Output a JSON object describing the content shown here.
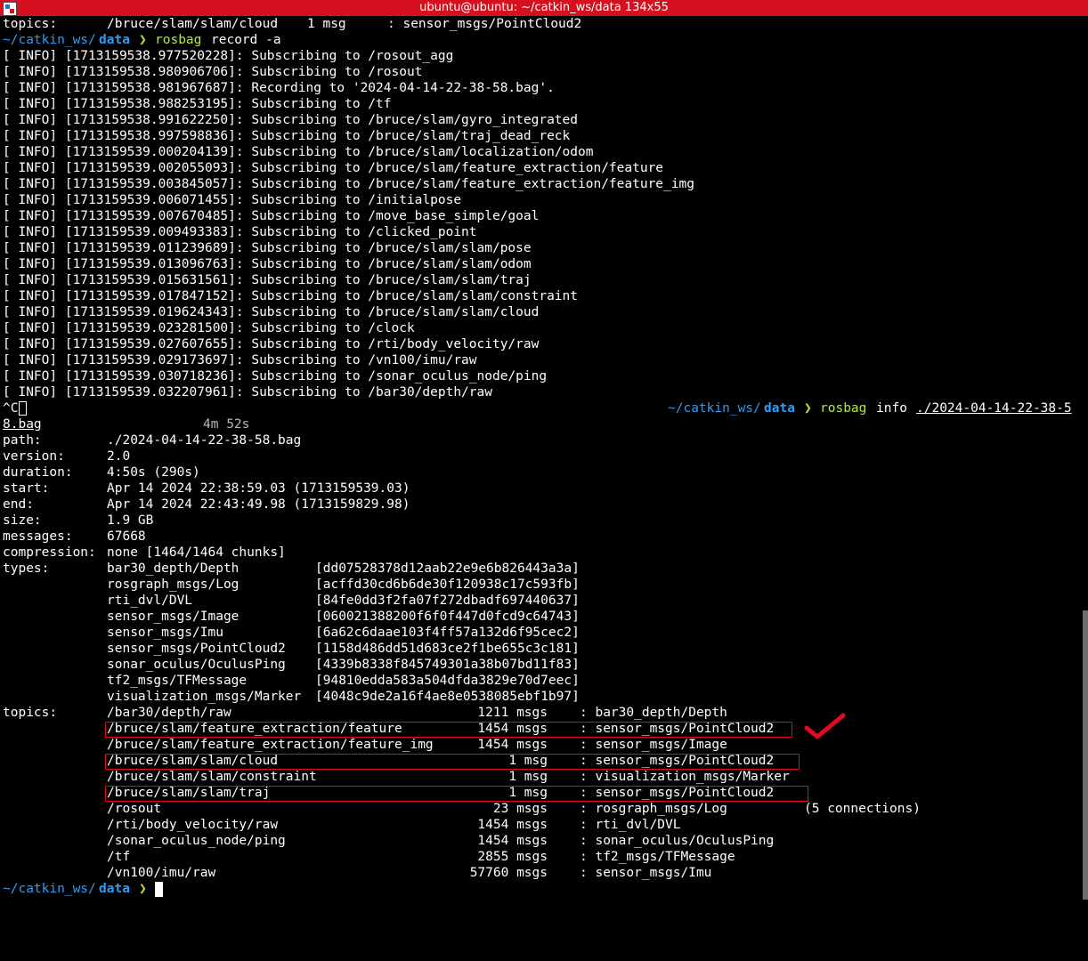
{
  "window": {
    "title": "ubuntu@ubuntu: ~/catkin_ws/data 134x55"
  },
  "first_line": {
    "label": "topics:",
    "topic": "/bruce/slam/slam/cloud",
    "count": "1 msg",
    "type": ": sensor_msgs/PointCloud2"
  },
  "prompt": {
    "dir_prefix": "~/catkin_ws/",
    "dir_name": "data",
    "arrow": "❯"
  },
  "command1": {
    "cmd": "rosbag",
    "args": "record -a"
  },
  "record_log": [
    "[ INFO] [1713159538.977520228]: Subscribing to /rosout_agg",
    "[ INFO] [1713159538.980906706]: Subscribing to /rosout",
    "[ INFO] [1713159538.981967687]: Recording to '2024-04-14-22-38-58.bag'.",
    "[ INFO] [1713159538.988253195]: Subscribing to /tf",
    "[ INFO] [1713159538.991622250]: Subscribing to /bruce/slam/gyro_integrated",
    "[ INFO] [1713159538.997598836]: Subscribing to /bruce/slam/traj_dead_reck",
    "[ INFO] [1713159539.000204139]: Subscribing to /bruce/slam/localization/odom",
    "[ INFO] [1713159539.002055093]: Subscribing to /bruce/slam/feature_extraction/feature",
    "[ INFO] [1713159539.003845057]: Subscribing to /bruce/slam/feature_extraction/feature_img",
    "[ INFO] [1713159539.006071455]: Subscribing to /initialpose",
    "[ INFO] [1713159539.007670485]: Subscribing to /move_base_simple/goal",
    "[ INFO] [1713159539.009493383]: Subscribing to /clicked_point",
    "[ INFO] [1713159539.011239689]: Subscribing to /bruce/slam/slam/pose",
    "[ INFO] [1713159539.013096763]: Subscribing to /bruce/slam/slam/odom",
    "[ INFO] [1713159539.015631561]: Subscribing to /bruce/slam/slam/traj",
    "[ INFO] [1713159539.017847152]: Subscribing to /bruce/slam/slam/constraint",
    "[ INFO] [1713159539.019624343]: Subscribing to /bruce/slam/slam/cloud",
    "[ INFO] [1713159539.023281500]: Subscribing to /clock",
    "[ INFO] [1713159539.027607655]: Subscribing to /rti/body_velocity/raw",
    "[ INFO] [1713159539.029173697]: Subscribing to /vn100/imu/raw",
    "[ INFO] [1713159539.030718236]: Subscribing to /sonar_oculus_node/ping",
    "[ INFO] [1713159539.032207961]: Subscribing to /bar30/depth/raw"
  ],
  "interrupt": "^C",
  "command2": {
    "cmd": "rosbag",
    "args": "info",
    "file_part1": "./2024-04-14-22-38-5",
    "file_part2": "8.bag",
    "elapsed": "4m 52s"
  },
  "info": {
    "path_label": "path:",
    "path_value": "./2024-04-14-22-38-58.bag",
    "version_label": "version:",
    "version_value": "2.0",
    "duration_label": "duration:",
    "duration_value": "4:50s (290s)",
    "start_label": "start:",
    "start_value": "Apr 14 2024 22:38:59.03 (1713159539.03)",
    "end_label": "end:",
    "end_value": "Apr 14 2024 22:43:49.98 (1713159829.98)",
    "size_label": "size:",
    "size_value": "1.9 GB",
    "messages_label": "messages:",
    "messages_value": "67668",
    "compression_label": "compression:",
    "compression_value": "none [1464/1464 chunks]",
    "types_label": "types:",
    "topics_label": "topics:"
  },
  "types": [
    {
      "name": "bar30_depth/Depth",
      "hash": "[dd07528378d12aab22e9e6b826443a3a]"
    },
    {
      "name": "rosgraph_msgs/Log",
      "hash": "[acffd30cd6b6de30f120938c17c593fb]"
    },
    {
      "name": "rti_dvl/DVL",
      "hash": "[84fe0dd3f2fa07f272dbadf697440637]"
    },
    {
      "name": "sensor_msgs/Image",
      "hash": "[060021388200f6f0f447d0fcd9c64743]"
    },
    {
      "name": "sensor_msgs/Imu",
      "hash": "[6a62c6daae103f4ff57a132d6f95cec2]"
    },
    {
      "name": "sensor_msgs/PointCloud2",
      "hash": "[1158d486dd51d683ce2f1be655c3c181]"
    },
    {
      "name": "sonar_oculus/OculusPing",
      "hash": "[4339b8338f845749301a38b07bd11f83]"
    },
    {
      "name": "tf2_msgs/TFMessage",
      "hash": "[94810edda583a504dfda3829e70d7eec]"
    },
    {
      "name": "visualization_msgs/Marker",
      "hash": "[4048c9de2a16f4ae8e0538085ebf1b97]"
    }
  ],
  "topics": [
    {
      "topic": "/bar30/depth/raw",
      "count": "1211 msgs",
      "type": ": bar30_depth/Depth",
      "extra": ""
    },
    {
      "topic": "/bruce/slam/feature_extraction/feature",
      "count": "1454 msgs",
      "type": ": sensor_msgs/PointCloud2",
      "extra": ""
    },
    {
      "topic": "/bruce/slam/feature_extraction/feature_img",
      "count": "1454 msgs",
      "type": ": sensor_msgs/Image",
      "extra": ""
    },
    {
      "topic": "/bruce/slam/slam/cloud",
      "count": "1 msg",
      "type": ": sensor_msgs/PointCloud2",
      "extra": ""
    },
    {
      "topic": "/bruce/slam/slam/constraint",
      "count": "1 msg",
      "type": ": visualization_msgs/Marker",
      "extra": ""
    },
    {
      "topic": "/bruce/slam/slam/traj",
      "count": "1 msg",
      "type": ": sensor_msgs/PointCloud2",
      "extra": ""
    },
    {
      "topic": "/rosout",
      "count": "23 msgs",
      "type": ": rosgraph_msgs/Log",
      "extra": "(5 connections)"
    },
    {
      "topic": "/rti/body_velocity/raw",
      "count": "1454 msgs",
      "type": ": rti_dvl/DVL",
      "extra": ""
    },
    {
      "topic": "/sonar_oculus_node/ping",
      "count": "1454 msgs",
      "type": ": sonar_oculus/OculusPing",
      "extra": ""
    },
    {
      "topic": "/tf",
      "count": "2855 msgs",
      "type": ": tf2_msgs/TFMessage",
      "extra": ""
    },
    {
      "topic": "/vn100/imu/raw",
      "count": "57760 msgs",
      "type": ": sensor_msgs/Imu",
      "extra": ""
    }
  ],
  "colors": {
    "titlebar": "#d7101f",
    "path": "#2f9df4",
    "arrow": "#b5ec3a",
    "highlight_box": "#e00b22"
  },
  "annotation_icons": [
    "checkmark-icon"
  ]
}
